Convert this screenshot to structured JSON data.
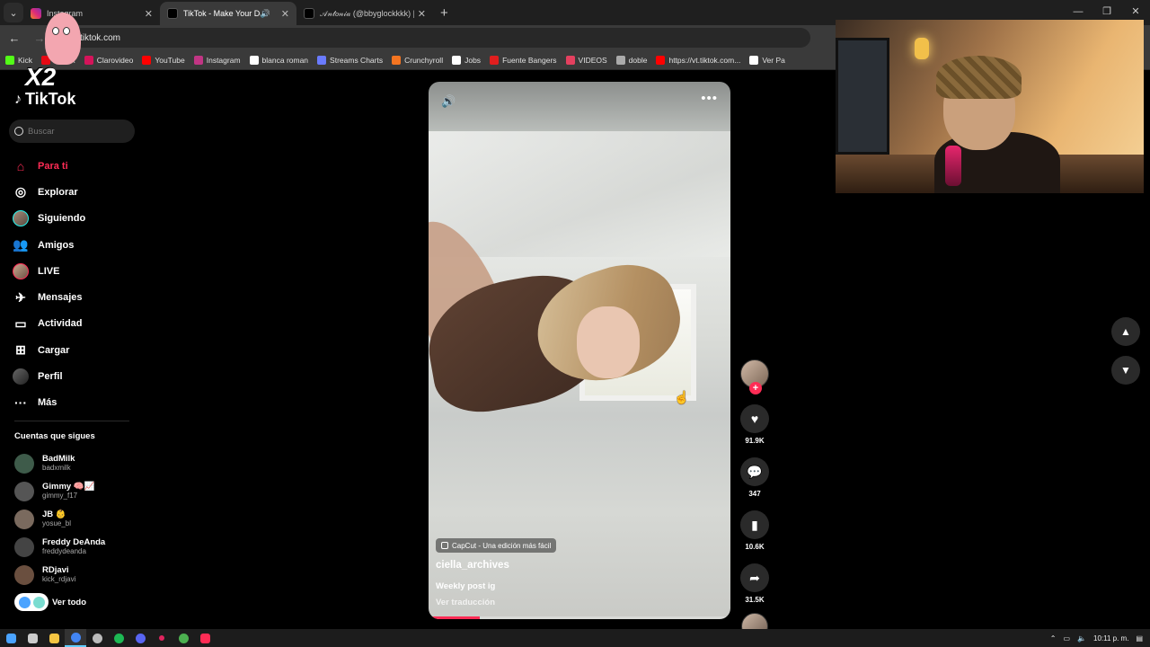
{
  "browser": {
    "tabs": [
      {
        "title": "Instagram",
        "active": false,
        "icon": "instagram-icon"
      },
      {
        "title": "TikTok - Make Your Day",
        "active": true,
        "icon": "tiktok-icon",
        "audio": true
      },
      {
        "title": "𝒜𝓃𝓉𝑜𝓃𝒾𝒶 (@bbyglockkkk) |",
        "active": false,
        "icon": "tiktok-icon"
      }
    ],
    "url": "tiktok.com",
    "bookmarks": [
      "Kick",
      "Netflix",
      "Clarovideo",
      "YouTube",
      "Instagram",
      "blanca roman",
      "Streams Charts",
      "Crunchyroll",
      "Jobs",
      "Fuente Bangers",
      "VIDEOS",
      "doble",
      "https://vt.tiktok.com...",
      "Ver Pa"
    ],
    "bookmark_colors": [
      "#53fc18",
      "#e50914",
      "#d4145a",
      "#ff0000",
      "#c13584",
      "#ffffff",
      "#6a7bff",
      "#f47521",
      "#ffffff",
      "#e01e1e",
      "#e4405f",
      "#aaaaaa",
      "#ff0000",
      "#ffffff",
      "#2fb389"
    ]
  },
  "overlay": {
    "multiplier": "X2"
  },
  "sidebar": {
    "logo": "TikTok",
    "search_placeholder": "Buscar",
    "menu": [
      {
        "label": "Para ti",
        "icon": "home-icon",
        "active": true
      },
      {
        "label": "Explorar",
        "icon": "compass-icon"
      },
      {
        "label": "Siguiendo",
        "icon": "following-avatar-icon"
      },
      {
        "label": "Amigos",
        "icon": "friends-icon"
      },
      {
        "label": "LIVE",
        "icon": "live-avatar-icon"
      },
      {
        "label": "Mensajes",
        "icon": "messages-icon"
      },
      {
        "label": "Actividad",
        "icon": "activity-icon"
      },
      {
        "label": "Cargar",
        "icon": "upload-icon"
      },
      {
        "label": "Perfil",
        "icon": "profile-avatar-icon"
      },
      {
        "label": "Más",
        "icon": "more-icon"
      }
    ],
    "following_header": "Cuentas que sigues",
    "following": [
      {
        "name": "BadMilk",
        "handle": "badxmilk",
        "color": "#3e5b4a"
      },
      {
        "name": "Gimmy 🧠📈",
        "handle": "gimmy_f17",
        "color": "#555555"
      },
      {
        "name": "JB 👶",
        "handle": "yosue_bl",
        "color": "#7a6a5e"
      },
      {
        "name": "Freddy DeAnda",
        "handle": "freddydeanda",
        "color": "#444444"
      },
      {
        "name": "RDjavi",
        "handle": "kick_rdjavi",
        "color": "#6a4f3f"
      }
    ],
    "see_all": "Ver todo"
  },
  "video": {
    "badge": "CapCut - Una edición más fácil",
    "author": "ciella_archives",
    "description": "Weekly post ig",
    "translate": "Ver traducción",
    "progress": 0.17
  },
  "actions": {
    "likes": "91.9K",
    "comments": "347",
    "saves": "10.6K",
    "shares": "31.5K"
  },
  "taskbar": {
    "time": "10:11 p. m.",
    "apps": [
      "windows-icon",
      "app-icon",
      "folder-icon",
      "chrome-icon",
      "circle-icon",
      "spotify-icon",
      "discord-icon",
      "dot-icon",
      "chrome-icon",
      "tiktok-icon"
    ],
    "app_colors": [
      "#4aa3ff",
      "#cccccc",
      "#f5c542",
      "#4285f4",
      "#bbbbbb",
      "#1db954",
      "#5865f2",
      "#e0245e",
      "#4caf50",
      "#fe2c55"
    ]
  }
}
